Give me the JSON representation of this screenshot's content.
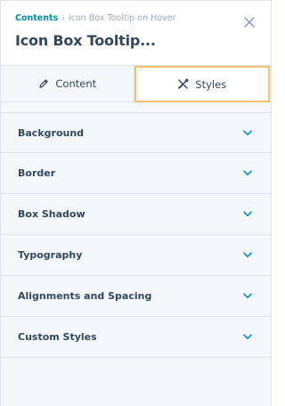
{
  "header": {
    "breadcrumb": {
      "root_label": "Contents",
      "separator": "›",
      "current_label": "Icon Box Tooltip on Hover"
    },
    "title": "Icon Box Tooltip..."
  },
  "tabs": [
    {
      "label": "Content",
      "icon": "pencil-icon",
      "active": false
    },
    {
      "label": "Styles",
      "icon": "tools-icon",
      "active": true
    }
  ],
  "sections": [
    {
      "label": "Background"
    },
    {
      "label": "Border"
    },
    {
      "label": "Box Shadow"
    },
    {
      "label": "Typography"
    },
    {
      "label": "Alignments and Spacing"
    },
    {
      "label": "Custom Styles"
    }
  ],
  "colors": {
    "link": "#0091ae",
    "text": "#33475b",
    "muted": "#99acc2",
    "active_tab_outline": "#f5c26b",
    "chevron": "#0091ae",
    "background": "#f5f8fa",
    "border": "#dfe3eb"
  }
}
